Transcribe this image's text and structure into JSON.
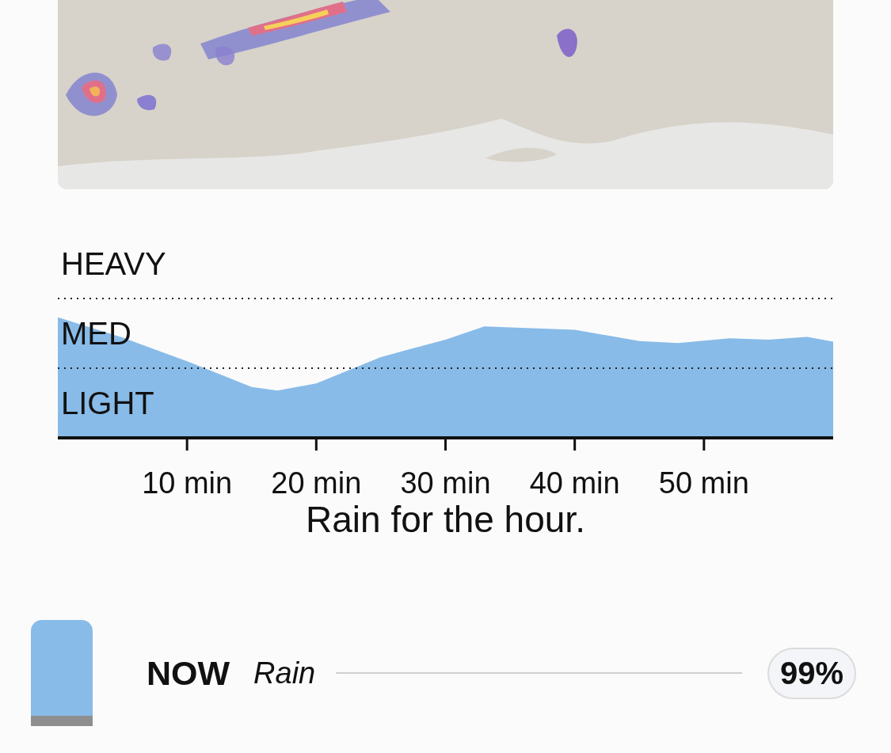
{
  "chart": {
    "levels": [
      "HEAVY",
      "MED",
      "LIGHT"
    ],
    "time_labels": [
      "10 min",
      "20 min",
      "30 min",
      "40 min",
      "50 min"
    ],
    "caption": "Rain for the hour."
  },
  "now_row": {
    "label": "NOW",
    "condition": "Rain",
    "probability": "99%"
  }
}
